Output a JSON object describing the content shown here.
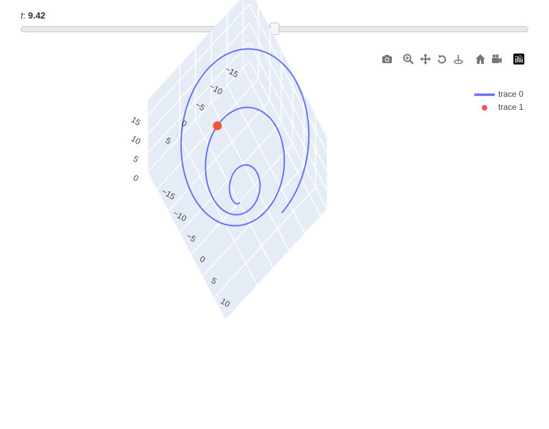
{
  "slider": {
    "variable": "t",
    "separator": ": ",
    "value_label": "9.42",
    "value": 9.42,
    "range": [
      0,
      18.85
    ]
  },
  "modebar": {
    "icons": [
      "camera-icon",
      "zoom-icon",
      "pan-icon",
      "orbit-rotation-icon",
      "turntable-rotation-icon",
      "home-icon",
      "camera-reset-icon",
      "plotly-logo-icon"
    ]
  },
  "chart_data": {
    "type": "line",
    "title": "",
    "series": [
      {
        "name": "trace 0",
        "mode": "lines",
        "color": "#636efa",
        "equation": "x = t·cos(t), y = t·sin(t), z = t",
        "t_range": [
          0,
          18.85
        ]
      },
      {
        "name": "trace 1",
        "mode": "markers",
        "color": "#ef553b",
        "x": [
          -9.42
        ],
        "y": [
          0.0
        ],
        "z": [
          9.42
        ]
      }
    ],
    "axes": {
      "x": {
        "ticks": [
          "−15",
          "−10",
          "−5",
          "0",
          "5",
          "10"
        ],
        "tick_values": [
          -15,
          -10,
          -5,
          0,
          5,
          10
        ],
        "range": [
          -19,
          15
        ]
      },
      "y": {
        "ticks": [
          "−15",
          "−10",
          "−5",
          "0",
          "5"
        ],
        "tick_values": [
          -15,
          -10,
          -5,
          0,
          5
        ],
        "range": [
          -17,
          15
        ]
      },
      "z": {
        "ticks": [
          "0",
          "5",
          "10",
          "15"
        ],
        "tick_values": [
          0,
          5,
          10,
          15
        ],
        "range": [
          0,
          19
        ]
      }
    },
    "grid": true,
    "legend_position": "top-right",
    "legend": [
      "trace 0",
      "trace 1"
    ]
  }
}
